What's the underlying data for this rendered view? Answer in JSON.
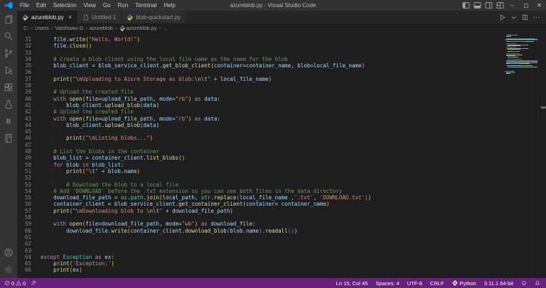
{
  "window": {
    "title": "azureblob.py - Visual Studio Code"
  },
  "menu": {
    "items": [
      "File",
      "Edit",
      "Selection",
      "View",
      "Go",
      "Run",
      "Terminal",
      "Help"
    ]
  },
  "titlebar_controls": {
    "layout": [
      "toggle-primary-sidebar",
      "toggle-panel",
      "toggle-secondary-sidebar",
      "customize-layout"
    ],
    "window": [
      "minimize",
      "maximize",
      "close"
    ]
  },
  "tabs": [
    {
      "label": "azureblob.py",
      "icon": "python",
      "active": true,
      "closable": true
    },
    {
      "label": "Untitled-1",
      "icon": "file-doc",
      "active": false,
      "closable": false
    },
    {
      "label": "blob-quickstart.py",
      "icon": "python",
      "active": false,
      "closable": false
    }
  ],
  "editor_actions": [
    {
      "name": "run-python-file",
      "icon": "run-play"
    },
    {
      "name": "run-dropdown",
      "icon": "chevron-down"
    },
    {
      "name": "split-editor",
      "icon": "split-editor"
    },
    {
      "name": "more-actions",
      "icon": "ellipsis"
    }
  ],
  "breadcrumb": {
    "segments": [
      {
        "label": "C:"
      },
      {
        "label": "Users"
      },
      {
        "label": "Vaishnavi.G"
      },
      {
        "label": "azureblob"
      },
      {
        "label": "azureblob.py",
        "icon": "python"
      },
      {
        "label": "..."
      }
    ]
  },
  "activity_bar": {
    "top": [
      "explorer",
      "search",
      "source-control",
      "run-and-debug",
      "extensions",
      "testing",
      "b-extension",
      "notebook"
    ],
    "bottom": [
      "accounts",
      "manage"
    ]
  },
  "editor": {
    "lines": [
      {
        "n": 31,
        "t": [
          [
            "w",
            "    "
          ],
          [
            "v",
            "file"
          ],
          [
            "o",
            "."
          ],
          [
            "f",
            "write"
          ],
          [
            "b1",
            "("
          ],
          [
            "s",
            "\"Hello, World!\""
          ],
          [
            "b1",
            ")"
          ]
        ]
      },
      {
        "n": 32,
        "t": [
          [
            "w",
            "    "
          ],
          [
            "v",
            "file"
          ],
          [
            "o",
            "."
          ],
          [
            "f",
            "close"
          ],
          [
            "b1",
            "()"
          ]
        ]
      },
      {
        "n": 33,
        "t": []
      },
      {
        "n": 34,
        "t": [
          [
            "w",
            "    "
          ],
          [
            "c",
            "# Create a blob client using the local file name as the name for the blob"
          ]
        ]
      },
      {
        "n": 35,
        "t": [
          [
            "w",
            "    "
          ],
          [
            "v",
            "blob_client"
          ],
          [
            "o",
            " = "
          ],
          [
            "v",
            "blob_service_client"
          ],
          [
            "o",
            "."
          ],
          [
            "f",
            "get_blob_client"
          ],
          [
            "b1",
            "("
          ],
          [
            "v",
            "container"
          ],
          [
            "o",
            "="
          ],
          [
            "v",
            "container_name"
          ],
          [
            "o",
            ", "
          ],
          [
            "v",
            "blob"
          ],
          [
            "o",
            "="
          ],
          [
            "v",
            "local_file_name"
          ],
          [
            "b1",
            ")"
          ]
        ]
      },
      {
        "n": 36,
        "t": []
      },
      {
        "n": 37,
        "t": [
          [
            "w",
            "    "
          ],
          [
            "f",
            "print"
          ],
          [
            "b1",
            "("
          ],
          [
            "s",
            "\""
          ],
          [
            "e",
            "\\n"
          ],
          [
            "s",
            "Uploading to Azure Storage as blob:"
          ],
          [
            "e",
            "\\n\\t"
          ],
          [
            "s",
            "\""
          ],
          [
            "o",
            " + "
          ],
          [
            "v",
            "local_file_name"
          ],
          [
            "b1",
            ")"
          ]
        ]
      },
      {
        "n": 38,
        "t": []
      },
      {
        "n": 39,
        "t": [
          [
            "w",
            "    "
          ],
          [
            "c",
            "# Upload the created file"
          ]
        ]
      },
      {
        "n": 40,
        "t": [
          [
            "w",
            "    "
          ],
          [
            "k",
            "with"
          ],
          [
            "f",
            " open"
          ],
          [
            "b1",
            "("
          ],
          [
            "v",
            "file"
          ],
          [
            "o",
            "="
          ],
          [
            "v",
            "upload_file_path"
          ],
          [
            "o",
            ", "
          ],
          [
            "v",
            "mode"
          ],
          [
            "o",
            "="
          ],
          [
            "s",
            "\"rb\""
          ],
          [
            "b1",
            ")"
          ],
          [
            "k",
            " as"
          ],
          [
            "v",
            " data"
          ],
          [
            "o",
            ":"
          ]
        ]
      },
      {
        "n": 41,
        "t": [
          [
            "w",
            "        "
          ],
          [
            "v",
            "blob_client"
          ],
          [
            "o",
            "."
          ],
          [
            "f",
            "upload_blob"
          ],
          [
            "b1",
            "("
          ],
          [
            "v",
            "data"
          ],
          [
            "b1",
            ")"
          ]
        ]
      },
      {
        "n": 42,
        "t": [
          [
            "w",
            "    "
          ],
          [
            "c",
            "# Upload the created file"
          ]
        ]
      },
      {
        "n": 43,
        "t": [
          [
            "w",
            "    "
          ],
          [
            "k",
            "with"
          ],
          [
            "f",
            " open"
          ],
          [
            "b1",
            "("
          ],
          [
            "v",
            "file"
          ],
          [
            "o",
            "="
          ],
          [
            "v",
            "upload_file_path"
          ],
          [
            "o",
            ", "
          ],
          [
            "v",
            "mode"
          ],
          [
            "o",
            "="
          ],
          [
            "s",
            "\"rb\""
          ],
          [
            "b1",
            ")"
          ],
          [
            "k",
            " as"
          ],
          [
            "v",
            " data"
          ],
          [
            "o",
            ":"
          ]
        ]
      },
      {
        "n": 44,
        "t": [
          [
            "w",
            "        "
          ],
          [
            "v",
            "blob_client"
          ],
          [
            "o",
            "."
          ],
          [
            "f",
            "upload_blob"
          ],
          [
            "b1",
            "("
          ],
          [
            "v",
            "data"
          ],
          [
            "b1",
            ")"
          ]
        ]
      },
      {
        "n": 45,
        "t": []
      },
      {
        "n": 46,
        "t": [
          [
            "w",
            "        "
          ],
          [
            "f",
            "print"
          ],
          [
            "b1",
            "("
          ],
          [
            "s",
            "\""
          ],
          [
            "e",
            "\\n"
          ],
          [
            "s",
            "Listing blobs...\""
          ],
          [
            "b1",
            ")"
          ]
        ]
      },
      {
        "n": 47,
        "t": []
      },
      {
        "n": 48,
        "t": [
          [
            "w",
            "    "
          ],
          [
            "c",
            "# List the blobs in the container"
          ]
        ]
      },
      {
        "n": 49,
        "t": [
          [
            "w",
            "    "
          ],
          [
            "v",
            "blob_list"
          ],
          [
            "o",
            " = "
          ],
          [
            "v",
            "container_client"
          ],
          [
            "o",
            "."
          ],
          [
            "f",
            "list_blobs"
          ],
          [
            "b1",
            "()"
          ]
        ]
      },
      {
        "n": 50,
        "t": [
          [
            "w",
            "    "
          ],
          [
            "k",
            "for"
          ],
          [
            "v",
            " blob"
          ],
          [
            "k",
            " in"
          ],
          [
            "v",
            " blob_list"
          ],
          [
            "o",
            ":"
          ]
        ]
      },
      {
        "n": 51,
        "t": [
          [
            "w",
            "        "
          ],
          [
            "f",
            "print"
          ],
          [
            "b1",
            "("
          ],
          [
            "s",
            "\""
          ],
          [
            "e",
            "\\t"
          ],
          [
            "s",
            "\""
          ],
          [
            "o",
            " + "
          ],
          [
            "v",
            "blob"
          ],
          [
            "o",
            "."
          ],
          [
            "v",
            "name"
          ],
          [
            "b1",
            ")"
          ]
        ]
      },
      {
        "n": 52,
        "t": []
      },
      {
        "n": 53,
        "t": [
          [
            "w",
            "        "
          ],
          [
            "c",
            "# Download the blob to a local file"
          ]
        ]
      },
      {
        "n": 54,
        "t": [
          [
            "w",
            "    "
          ],
          [
            "c",
            "# Add 'DOWNLOAD' before the .txt extension so you can see both files in the data directory"
          ]
        ]
      },
      {
        "n": 55,
        "t": [
          [
            "w",
            "    "
          ],
          [
            "v",
            "download_file_path"
          ],
          [
            "o",
            " = "
          ],
          [
            "t",
            "os"
          ],
          [
            "o",
            "."
          ],
          [
            "t",
            "path"
          ],
          [
            "o",
            "."
          ],
          [
            "f",
            "join"
          ],
          [
            "b1",
            "("
          ],
          [
            "v",
            "local_path"
          ],
          [
            "o",
            ", "
          ],
          [
            "t",
            "str"
          ],
          [
            "o",
            "."
          ],
          [
            "f",
            "replace"
          ],
          [
            "b2",
            "("
          ],
          [
            "v",
            "local_file_name"
          ],
          [
            "o",
            " ,"
          ],
          [
            "s",
            "'.txt'"
          ],
          [
            "o",
            ", "
          ],
          [
            "s",
            "'DOWNLOAD.txt'"
          ],
          [
            "b2",
            ")"
          ],
          [
            "b1",
            ")"
          ]
        ]
      },
      {
        "n": 56,
        "t": [
          [
            "w",
            "    "
          ],
          [
            "v",
            "container_client"
          ],
          [
            "o",
            " = "
          ],
          [
            "v",
            "blob_service_client"
          ],
          [
            "o",
            "."
          ],
          [
            "f",
            "get_container_client"
          ],
          [
            "b1",
            "("
          ],
          [
            "v",
            "container"
          ],
          [
            "o",
            "= "
          ],
          [
            "v",
            "container_name"
          ],
          [
            "b1",
            ")"
          ]
        ]
      },
      {
        "n": 57,
        "t": [
          [
            "w",
            "    "
          ],
          [
            "f",
            "print"
          ],
          [
            "b1",
            "("
          ],
          [
            "s",
            "\""
          ],
          [
            "e",
            "\\n"
          ],
          [
            "s",
            "Downloading blob to "
          ],
          [
            "e",
            "\\n\\t"
          ],
          [
            "s",
            "\""
          ],
          [
            "o",
            " + "
          ],
          [
            "v",
            "download_file_path"
          ],
          [
            "b1",
            ")"
          ]
        ]
      },
      {
        "n": 58,
        "t": []
      },
      {
        "n": 59,
        "t": [
          [
            "w",
            "    "
          ],
          [
            "k",
            "with"
          ],
          [
            "f",
            " open"
          ],
          [
            "b1",
            "("
          ],
          [
            "v",
            "file"
          ],
          [
            "o",
            "="
          ],
          [
            "v",
            "download_file_path"
          ],
          [
            "o",
            ", "
          ],
          [
            "v",
            "mode"
          ],
          [
            "o",
            "="
          ],
          [
            "s",
            "\"wb\""
          ],
          [
            "b1",
            ")"
          ],
          [
            "k",
            " as"
          ],
          [
            "v",
            " download_file"
          ],
          [
            "o",
            ":"
          ]
        ]
      },
      {
        "n": 60,
        "t": [
          [
            "w",
            "        "
          ],
          [
            "v",
            "download_file"
          ],
          [
            "o",
            "."
          ],
          [
            "f",
            "write"
          ],
          [
            "b1",
            "("
          ],
          [
            "v",
            "container_client"
          ],
          [
            "o",
            "."
          ],
          [
            "f",
            "download_blob"
          ],
          [
            "b2",
            "("
          ],
          [
            "v",
            "blob"
          ],
          [
            "o",
            "."
          ],
          [
            "v",
            "name"
          ],
          [
            "b2",
            ")"
          ],
          [
            "o",
            "."
          ],
          [
            "f",
            "readall"
          ],
          [
            "b3",
            "()"
          ],
          [
            "b1",
            ")"
          ]
        ]
      },
      {
        "n": 61,
        "t": []
      },
      {
        "n": 62,
        "t": []
      },
      {
        "n": 63,
        "t": []
      },
      {
        "n": 64,
        "t": [
          [
            "k",
            "except"
          ],
          [
            "t",
            " Exception"
          ],
          [
            "k",
            " as"
          ],
          [
            "v",
            " ex"
          ],
          [
            "o",
            ":"
          ]
        ]
      },
      {
        "n": 65,
        "t": [
          [
            "w",
            "    "
          ],
          [
            "f",
            "print"
          ],
          [
            "b1",
            "("
          ],
          [
            "s",
            "'Exception:'"
          ],
          [
            "b1",
            ")"
          ]
        ]
      },
      {
        "n": 66,
        "t": [
          [
            "w",
            "    "
          ],
          [
            "f",
            "print"
          ],
          [
            "b1",
            "("
          ],
          [
            "v",
            "ex"
          ],
          [
            "b1",
            ")"
          ]
        ]
      }
    ]
  },
  "status_bar": {
    "errors": "0",
    "warnings": "0",
    "left_icons": [
      "rocket"
    ],
    "right": [
      {
        "name": "cursor-position",
        "label": "Ln 15, Col 45"
      },
      {
        "name": "indentation",
        "label": "Spaces: 4"
      },
      {
        "name": "encoding",
        "label": "UTF-8"
      },
      {
        "name": "eol",
        "label": "CRLF"
      },
      {
        "name": "language-mode",
        "label": "Python",
        "icon": "python-mini"
      },
      {
        "name": "interpreter",
        "label": "3.11.1 64-bit"
      },
      {
        "name": "feedback",
        "icon": "feedback"
      },
      {
        "name": "notifications",
        "icon": "bell"
      }
    ]
  },
  "colors": {
    "titlebar": "#323233",
    "tabbar": "#252526",
    "tab_inactive": "#2d2d2d",
    "editor": "#1e1e1e",
    "activitybar": "#333333",
    "statusbar": "#68217a",
    "python_blue": "#3776ab",
    "python_yellow": "#ffd43b",
    "tokens": {
      "c": "#6a9955",
      "k": "#c586c0",
      "f": "#dcdcaa",
      "v": "#9cdcfe",
      "s": "#ce9178",
      "e": "#d7ba7d",
      "o": "#d4d4d4",
      "t": "#4ec9b0",
      "b1": "#ffd700",
      "b2": "#da70d6",
      "b3": "#179fff"
    }
  }
}
